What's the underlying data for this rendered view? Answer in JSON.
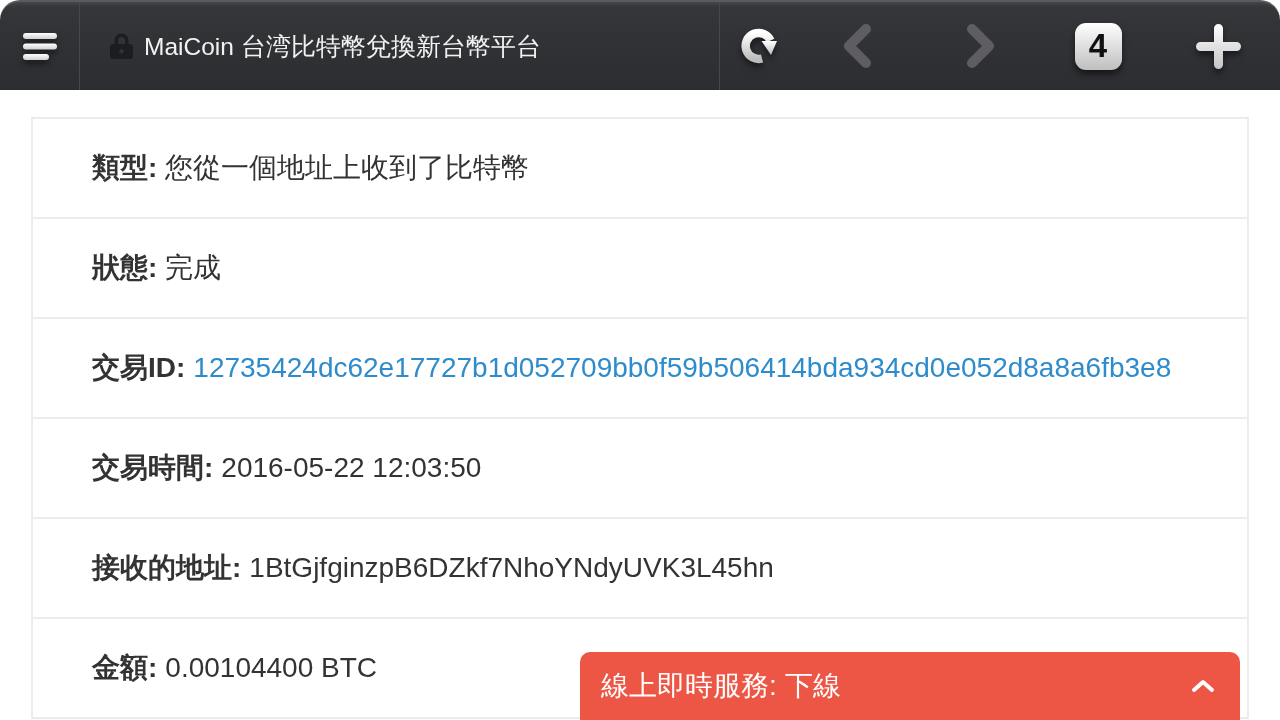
{
  "browser_toolbar": {
    "title": "MaiCoin 台湾比特幣兌換新台幣平台",
    "secure": true,
    "nav_buttons": [
      {
        "kind": "back",
        "disabled": true
      },
      {
        "kind": "forward",
        "disabled": true
      }
    ],
    "tab_count": "4"
  },
  "details": [
    {
      "label": "類型:",
      "value": "您從一個地址上收到了比特幣",
      "kind": "text"
    },
    {
      "label": "狀態:",
      "value": "完成",
      "kind": "text"
    },
    {
      "label": "交易ID:",
      "value": "12735424dc62e17727b1d052709bb0f59b506414bda934cd0e052d8a8a6fb3e8",
      "kind": "link"
    },
    {
      "label": "交易時間:",
      "value": "2016-05-22 12:03:50",
      "kind": "text"
    },
    {
      "label": "接收的地址:",
      "value": "1BtGjfginzpB6DZkf7NhoYNdyUVK3L45hn",
      "kind": "text"
    },
    {
      "label": "金額:",
      "value": "0.00104400 BTC",
      "kind": "text"
    }
  ],
  "chat_bar": {
    "title": "線上即時服務: 下線",
    "expanded": false
  }
}
